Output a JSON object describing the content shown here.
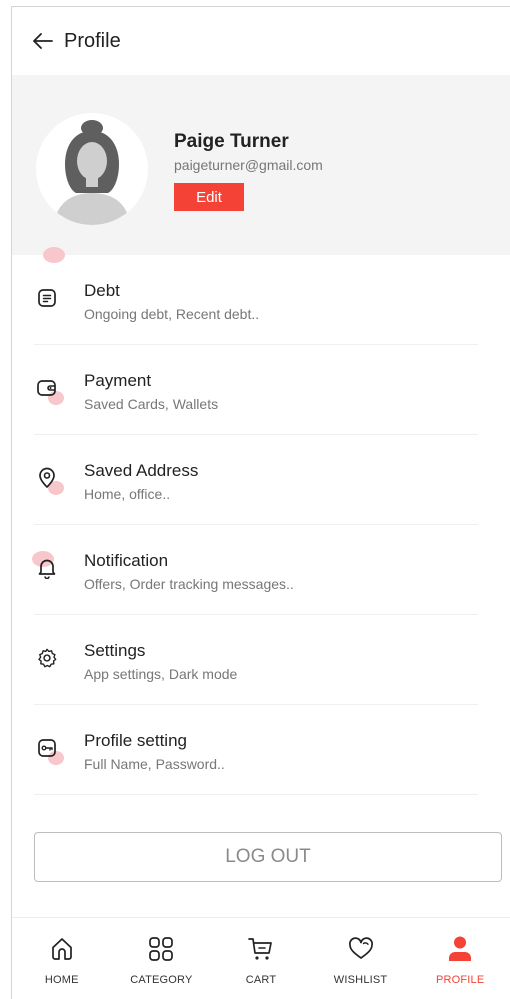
{
  "header": {
    "title": "Profile",
    "back_icon": "arrow-left-icon"
  },
  "profile": {
    "name": "Paige Turner",
    "email": "paigeturner@gmail.com",
    "edit_label": "Edit"
  },
  "menu": [
    {
      "icon": "document-icon",
      "label": "Debt",
      "sub": "Ongoing debt, Recent debt.."
    },
    {
      "icon": "wallet-icon",
      "label": "Payment",
      "sub": "Saved Cards, Wallets"
    },
    {
      "icon": "location-pin-icon",
      "label": "Saved Address",
      "sub": "Home, office.."
    },
    {
      "icon": "bell-icon",
      "label": "Notification",
      "sub": "Offers, Order tracking messages.."
    },
    {
      "icon": "gear-icon",
      "label": "Settings",
      "sub": "App settings, Dark mode"
    },
    {
      "icon": "key-icon",
      "label": "Profile setting",
      "sub": "Full Name, Password.."
    }
  ],
  "logout_label": "LOG OUT",
  "bottom_nav": [
    {
      "icon": "home-icon",
      "label": "HOME",
      "active": false
    },
    {
      "icon": "grid-icon",
      "label": "CATEGORY",
      "active": false
    },
    {
      "icon": "cart-icon",
      "label": "CART",
      "active": false
    },
    {
      "icon": "heart-icon",
      "label": "WISHLIST",
      "active": false
    },
    {
      "icon": "user-icon",
      "label": "PROFILE",
      "active": true
    }
  ],
  "colors": {
    "accent": "#f44336",
    "card_bg": "#f4f4f5",
    "accent_soft": "#f7c7cc"
  }
}
